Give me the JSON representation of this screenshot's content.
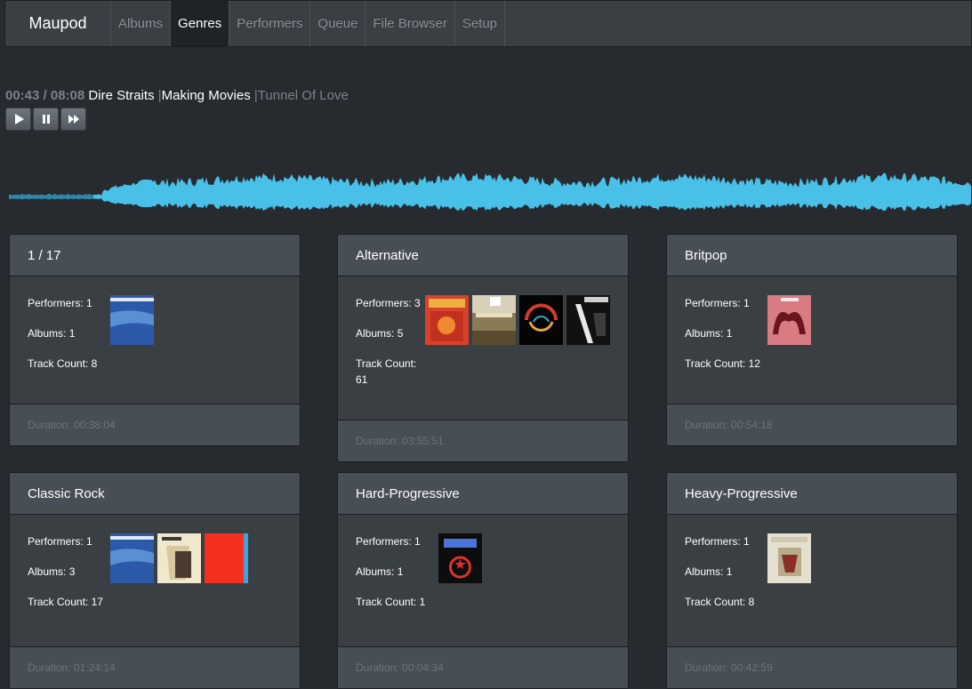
{
  "app": {
    "brand": "Maupod"
  },
  "nav": [
    {
      "label": "Albums"
    },
    {
      "label": "Genres"
    },
    {
      "label": "Performers"
    },
    {
      "label": "Queue"
    },
    {
      "label": "File Browser"
    },
    {
      "label": "Setup"
    }
  ],
  "nav_active": "Genres",
  "player": {
    "time": "00:43 / 08:08",
    "artist": "Dire Straits",
    "album": "Making Movies",
    "track": "Tunnel Of Love",
    "progress_fraction": 0.088,
    "wave_played_color": "#2f87a9",
    "wave_color": "#49c0e8"
  },
  "labels": {
    "performers": "Performers:",
    "albums": "Albums:",
    "tracks": "Track Count:",
    "duration": "Duration:"
  },
  "genres": [
    {
      "name": "1 / 17",
      "performers": "1",
      "albums": "1",
      "tracks": "8",
      "duration": "00:38:04",
      "covers": [
        "blue-sky-cover"
      ]
    },
    {
      "name": "Alternative",
      "performers": "3",
      "albums": "5",
      "tracks": "61",
      "duration": "03:55:51",
      "covers": [
        "red-orange-cover",
        "angela-desert-cover",
        "dark-arc-cover",
        "angela-black-cover"
      ]
    },
    {
      "name": "Britpop",
      "performers": "1",
      "albums": "1",
      "tracks": "12",
      "duration": "00:54:18",
      "covers": [
        "red-figure-cover"
      ]
    },
    {
      "name": "Classic Rock",
      "performers": "1",
      "albums": "3",
      "tracks": "17",
      "duration": "01:24:14",
      "covers": [
        "blue-sky-cover",
        "cream-hands-cover",
        "red-solid-cover"
      ]
    },
    {
      "name": "Hard-Progressive",
      "performers": "1",
      "albums": "1",
      "tracks": "1",
      "duration": "00:04:34",
      "covers": [
        "dark-star-cover"
      ]
    },
    {
      "name": "Heavy-Progressive",
      "performers": "1",
      "albums": "1",
      "tracks": "8",
      "duration": "00:42:59",
      "covers": [
        "beige-painting-cover"
      ]
    }
  ]
}
